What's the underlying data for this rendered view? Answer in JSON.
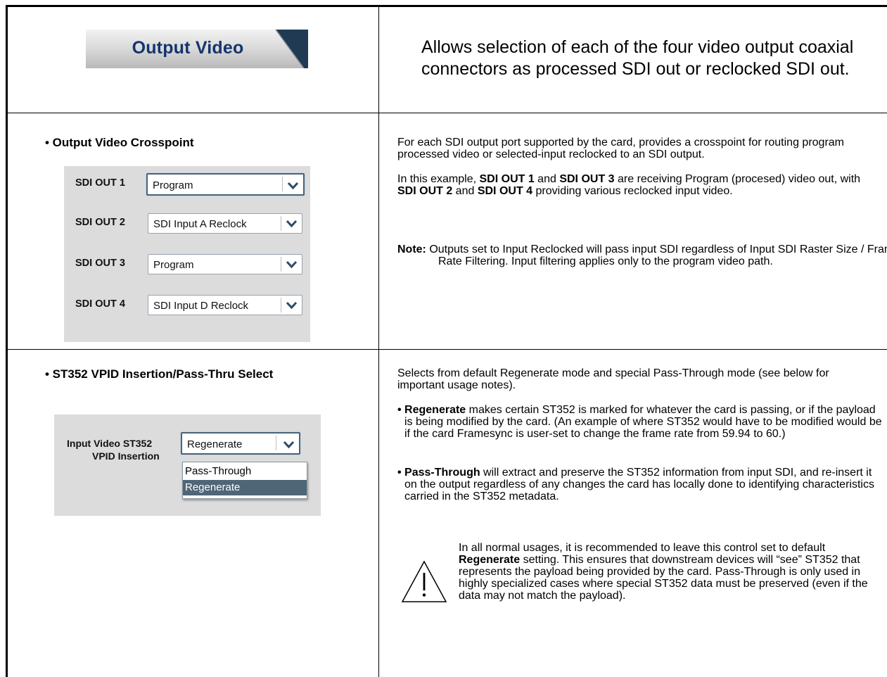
{
  "header": {
    "tab_label": "Output Video",
    "intro": "Allows selection of each of the four video output coaxial connectors as processed SDI out or reclocked SDI out."
  },
  "crosspoint": {
    "title": "• Output Video Crosspoint",
    "rows": [
      {
        "label": "SDI OUT 1",
        "value": "Program"
      },
      {
        "label": "SDI OUT 2",
        "value": "SDI Input A Reclock"
      },
      {
        "label": "SDI OUT 3",
        "value": "Program"
      },
      {
        "label": "SDI OUT 4",
        "value": "SDI Input D Reclock"
      }
    ],
    "desc": "For each SDI output port supported by the card, provides a crosspoint for routing program processed video or selected-input reclocked to an SDI output.",
    "example": {
      "p1": "In this example, ",
      "b1": "SDI OUT 1",
      "p2": " and ",
      "b2": "SDI OUT 3",
      "p3": " are receiving Program (procesed) video out, with ",
      "b3": "SDI OUT 2",
      "p4": " and ",
      "b4": "SDI OUT 4",
      "p5": " providing various reclocked input video."
    },
    "note": {
      "label": "Note:",
      "text": " Outputs set to Input Reclocked will pass input SDI regardless of Input SDI Raster Size / Frame Rate Filtering. Input filtering applies only to the program video path."
    }
  },
  "vpid": {
    "title": "• ST352 VPID Insertion/Pass-Thru Select",
    "label_line1": "Input Video ST352",
    "label_line2": "VPID Insertion",
    "value": "Regenerate",
    "options": [
      "Pass-Through",
      "Regenerate"
    ],
    "selected_option": "Regenerate",
    "desc": "Selects from default Regenerate mode and special Pass-Through mode (see below for important usage notes).",
    "bullet1_bold": "• Regenerate",
    "bullet1_text": " makes certain ST352 is marked for whatever the card is passing, or if the payload is being modified by the card. (An example of where ST352 would have to be modified would be if the card Framesync is user-set to change the frame rate from 59.94 to 60.)",
    "bullet2_bold": "• Pass-Through",
    "bullet2_text": " will extract and preserve the ST352 information from input SDI, and re-insert it on the output regardless of any changes the card has locally done to identifying characteristics carried in the ST352 metadata.",
    "caution_p1": "In all normal usages, it is recommended to leave this control set to default ",
    "caution_b": "Regenerate",
    "caution_p2": " setting. This ensures that downstream devices will “see” ST352 that represents the payload being provided by the card. Pass-Through is only used in highly specialized cases where special ST352 data must be preserved (even if the data may not match the payload)."
  },
  "colors": {
    "tab_text": "#14356e",
    "panel_bg": "#dcdcdc",
    "selected_bg": "#4f6677"
  }
}
